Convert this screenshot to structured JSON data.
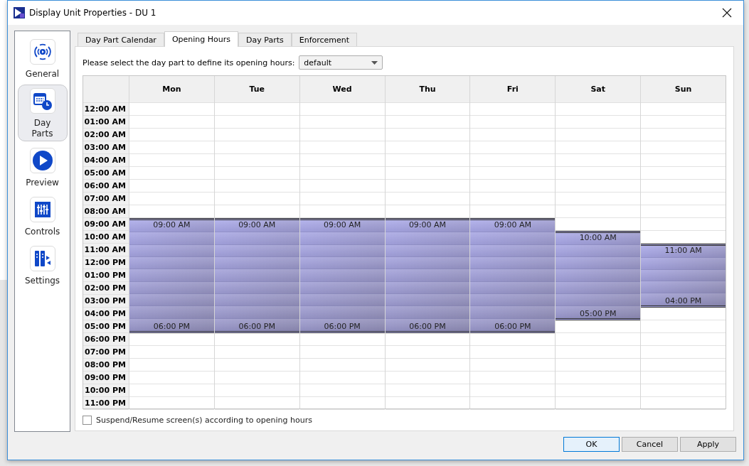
{
  "window": {
    "title": "Display Unit Properties - DU 1"
  },
  "nav": [
    {
      "label": "General",
      "kind": "broadcast",
      "selected": false
    },
    {
      "label": "Day Parts",
      "kind": "calendar",
      "selected": true
    },
    {
      "label": "Preview",
      "kind": "play",
      "selected": false
    },
    {
      "label": "Controls",
      "kind": "sliders",
      "selected": false
    },
    {
      "label": "Settings",
      "kind": "columns",
      "selected": false
    }
  ],
  "tabs": [
    {
      "label": "Day Part Calendar",
      "selected": false
    },
    {
      "label": "Opening Hours",
      "selected": true
    },
    {
      "label": "Day Parts",
      "selected": false
    },
    {
      "label": "Enforcement",
      "selected": false
    }
  ],
  "day_part_selector": {
    "label": "Please select the day part to define its opening hours:",
    "value": "default"
  },
  "schedule": {
    "hours": [
      "12:00 AM",
      "01:00 AM",
      "02:00 AM",
      "03:00 AM",
      "04:00 AM",
      "05:00 AM",
      "06:00 AM",
      "07:00 AM",
      "08:00 AM",
      "09:00 AM",
      "10:00 AM",
      "11:00 AM",
      "12:00 PM",
      "01:00 PM",
      "02:00 PM",
      "03:00 PM",
      "04:00 PM",
      "05:00 PM",
      "06:00 PM",
      "07:00 PM",
      "08:00 PM",
      "09:00 PM",
      "10:00 PM",
      "11:00 PM"
    ],
    "days": [
      {
        "name": "Mon",
        "open": "09:00 AM",
        "close": "06:00 PM",
        "open_hours": [
          false,
          false,
          false,
          false,
          false,
          false,
          false,
          false,
          false,
          true,
          true,
          true,
          true,
          true,
          true,
          true,
          true,
          true,
          false,
          false,
          false,
          false,
          false,
          false
        ]
      },
      {
        "name": "Tue",
        "open": "09:00 AM",
        "close": "06:00 PM",
        "open_hours": [
          false,
          false,
          false,
          false,
          false,
          false,
          false,
          false,
          false,
          true,
          true,
          true,
          true,
          true,
          true,
          true,
          true,
          true,
          false,
          false,
          false,
          false,
          false,
          false
        ]
      },
      {
        "name": "Wed",
        "open": "09:00 AM",
        "close": "06:00 PM",
        "open_hours": [
          false,
          false,
          false,
          false,
          false,
          false,
          false,
          false,
          false,
          true,
          true,
          true,
          true,
          true,
          true,
          true,
          true,
          true,
          false,
          false,
          false,
          false,
          false,
          false
        ]
      },
      {
        "name": "Thu",
        "open": "09:00 AM",
        "close": "06:00 PM",
        "open_hours": [
          false,
          false,
          false,
          false,
          false,
          false,
          false,
          false,
          false,
          true,
          true,
          true,
          true,
          true,
          true,
          true,
          true,
          true,
          false,
          false,
          false,
          false,
          false,
          false
        ]
      },
      {
        "name": "Fri",
        "open": "09:00 AM",
        "close": "06:00 PM",
        "open_hours": [
          false,
          false,
          false,
          false,
          false,
          false,
          false,
          false,
          false,
          true,
          true,
          true,
          true,
          true,
          true,
          true,
          true,
          true,
          false,
          false,
          false,
          false,
          false,
          false
        ]
      },
      {
        "name": "Sat",
        "open": "10:00 AM",
        "close": "05:00 PM",
        "open_hours": [
          false,
          false,
          false,
          false,
          false,
          false,
          false,
          false,
          false,
          false,
          true,
          true,
          true,
          true,
          true,
          true,
          true,
          false,
          false,
          false,
          false,
          false,
          false,
          false
        ]
      },
      {
        "name": "Sun",
        "open": "11:00 AM",
        "close": "04:00 PM",
        "open_hours": [
          false,
          false,
          false,
          false,
          false,
          false,
          false,
          false,
          false,
          false,
          false,
          true,
          true,
          true,
          true,
          true,
          false,
          false,
          false,
          false,
          false,
          false,
          false,
          false
        ]
      }
    ]
  },
  "suspend_option": {
    "label": "Suspend/Resume screen(s) according to opening hours",
    "checked": false
  },
  "buttons": [
    {
      "label": "OK",
      "default": true
    },
    {
      "label": "Cancel",
      "default": false
    },
    {
      "label": "Apply",
      "default": false
    }
  ]
}
